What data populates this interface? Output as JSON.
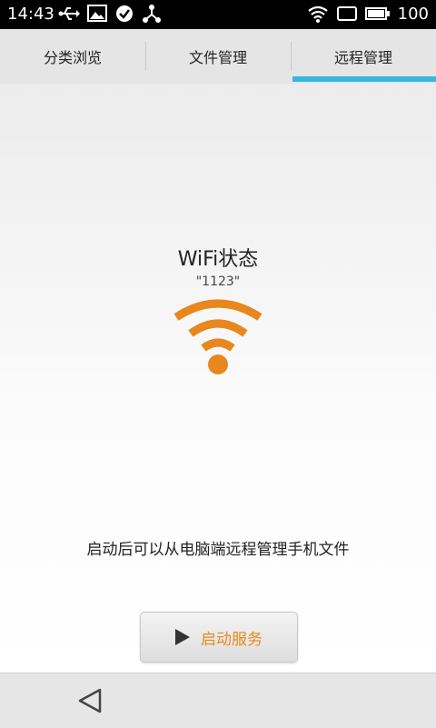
{
  "status_bar": {
    "time": "14:43",
    "battery": "100",
    "icons": [
      "usb-icon",
      "image-icon",
      "check-circle-icon",
      "share-icon",
      "wifi-signal-icon",
      "tablet-icon",
      "battery-icon"
    ]
  },
  "tabs": [
    {
      "label": "分类浏览",
      "active": false
    },
    {
      "label": "文件管理",
      "active": false
    },
    {
      "label": "远程管理",
      "active": true
    }
  ],
  "main": {
    "wifi_title": "WiFi状态",
    "wifi_name": "\"1123\"",
    "hint": "启动后可以从电脑端远程管理手机文件",
    "start_button_label": "启动服务"
  },
  "colors": {
    "accent": "#37b7df",
    "wifi_orange": "#e8871e",
    "button_text": "#e68a1a"
  }
}
